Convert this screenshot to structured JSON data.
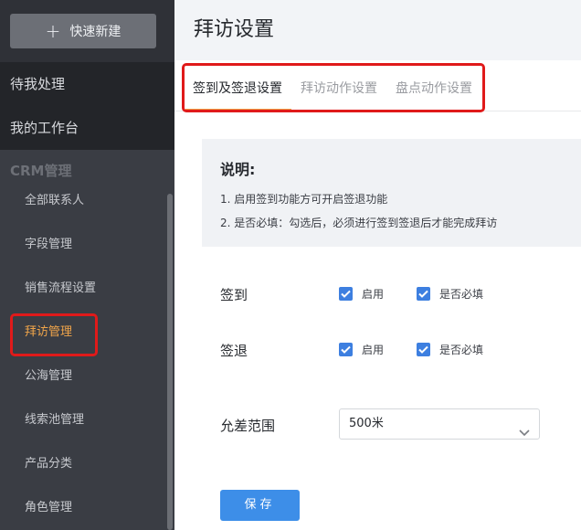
{
  "sidebar": {
    "new_button": {
      "icon": "plus-icon",
      "label": "快速新建"
    },
    "main_items": [
      {
        "label": "待我处理"
      },
      {
        "label": "我的工作台"
      }
    ],
    "group_title": "CRM管理",
    "sub_items": [
      {
        "label": "全部联系人"
      },
      {
        "label": "字段管理"
      },
      {
        "label": "销售流程设置"
      },
      {
        "label": "拜访管理",
        "active": true
      },
      {
        "label": "公海管理"
      },
      {
        "label": "线索池管理"
      },
      {
        "label": "产品分类"
      },
      {
        "label": "角色管理"
      }
    ]
  },
  "page": {
    "title": "拜访设置",
    "tabs": [
      {
        "label": "签到及签退设置",
        "active": true
      },
      {
        "label": "拜访动作设置"
      },
      {
        "label": "盘点动作设置"
      }
    ],
    "note": {
      "title": "说明:",
      "lines": [
        "1. 启用签到功能方可开启签退功能",
        "2. 是否必填：勾选后，必须进行签到签退后才能完成拜访"
      ]
    },
    "checkin": {
      "label": "签到",
      "enable_label": "启用",
      "enable_checked": true,
      "required_label": "是否必填",
      "required_checked": true
    },
    "checkout": {
      "label": "签退",
      "enable_label": "启用",
      "enable_checked": true,
      "required_label": "是否必填",
      "required_checked": true
    },
    "range": {
      "label": "允差范围",
      "value": "500米",
      "icon": "chevron-down-icon"
    },
    "save_label": "保存"
  },
  "colors": {
    "accent_orange": "#f0a54a",
    "primary_blue": "#3d8ee8",
    "checkbox_blue": "#3d7fe0",
    "highlight_red": "#e01a1a",
    "sidebar_bg": "#3a3d44"
  }
}
